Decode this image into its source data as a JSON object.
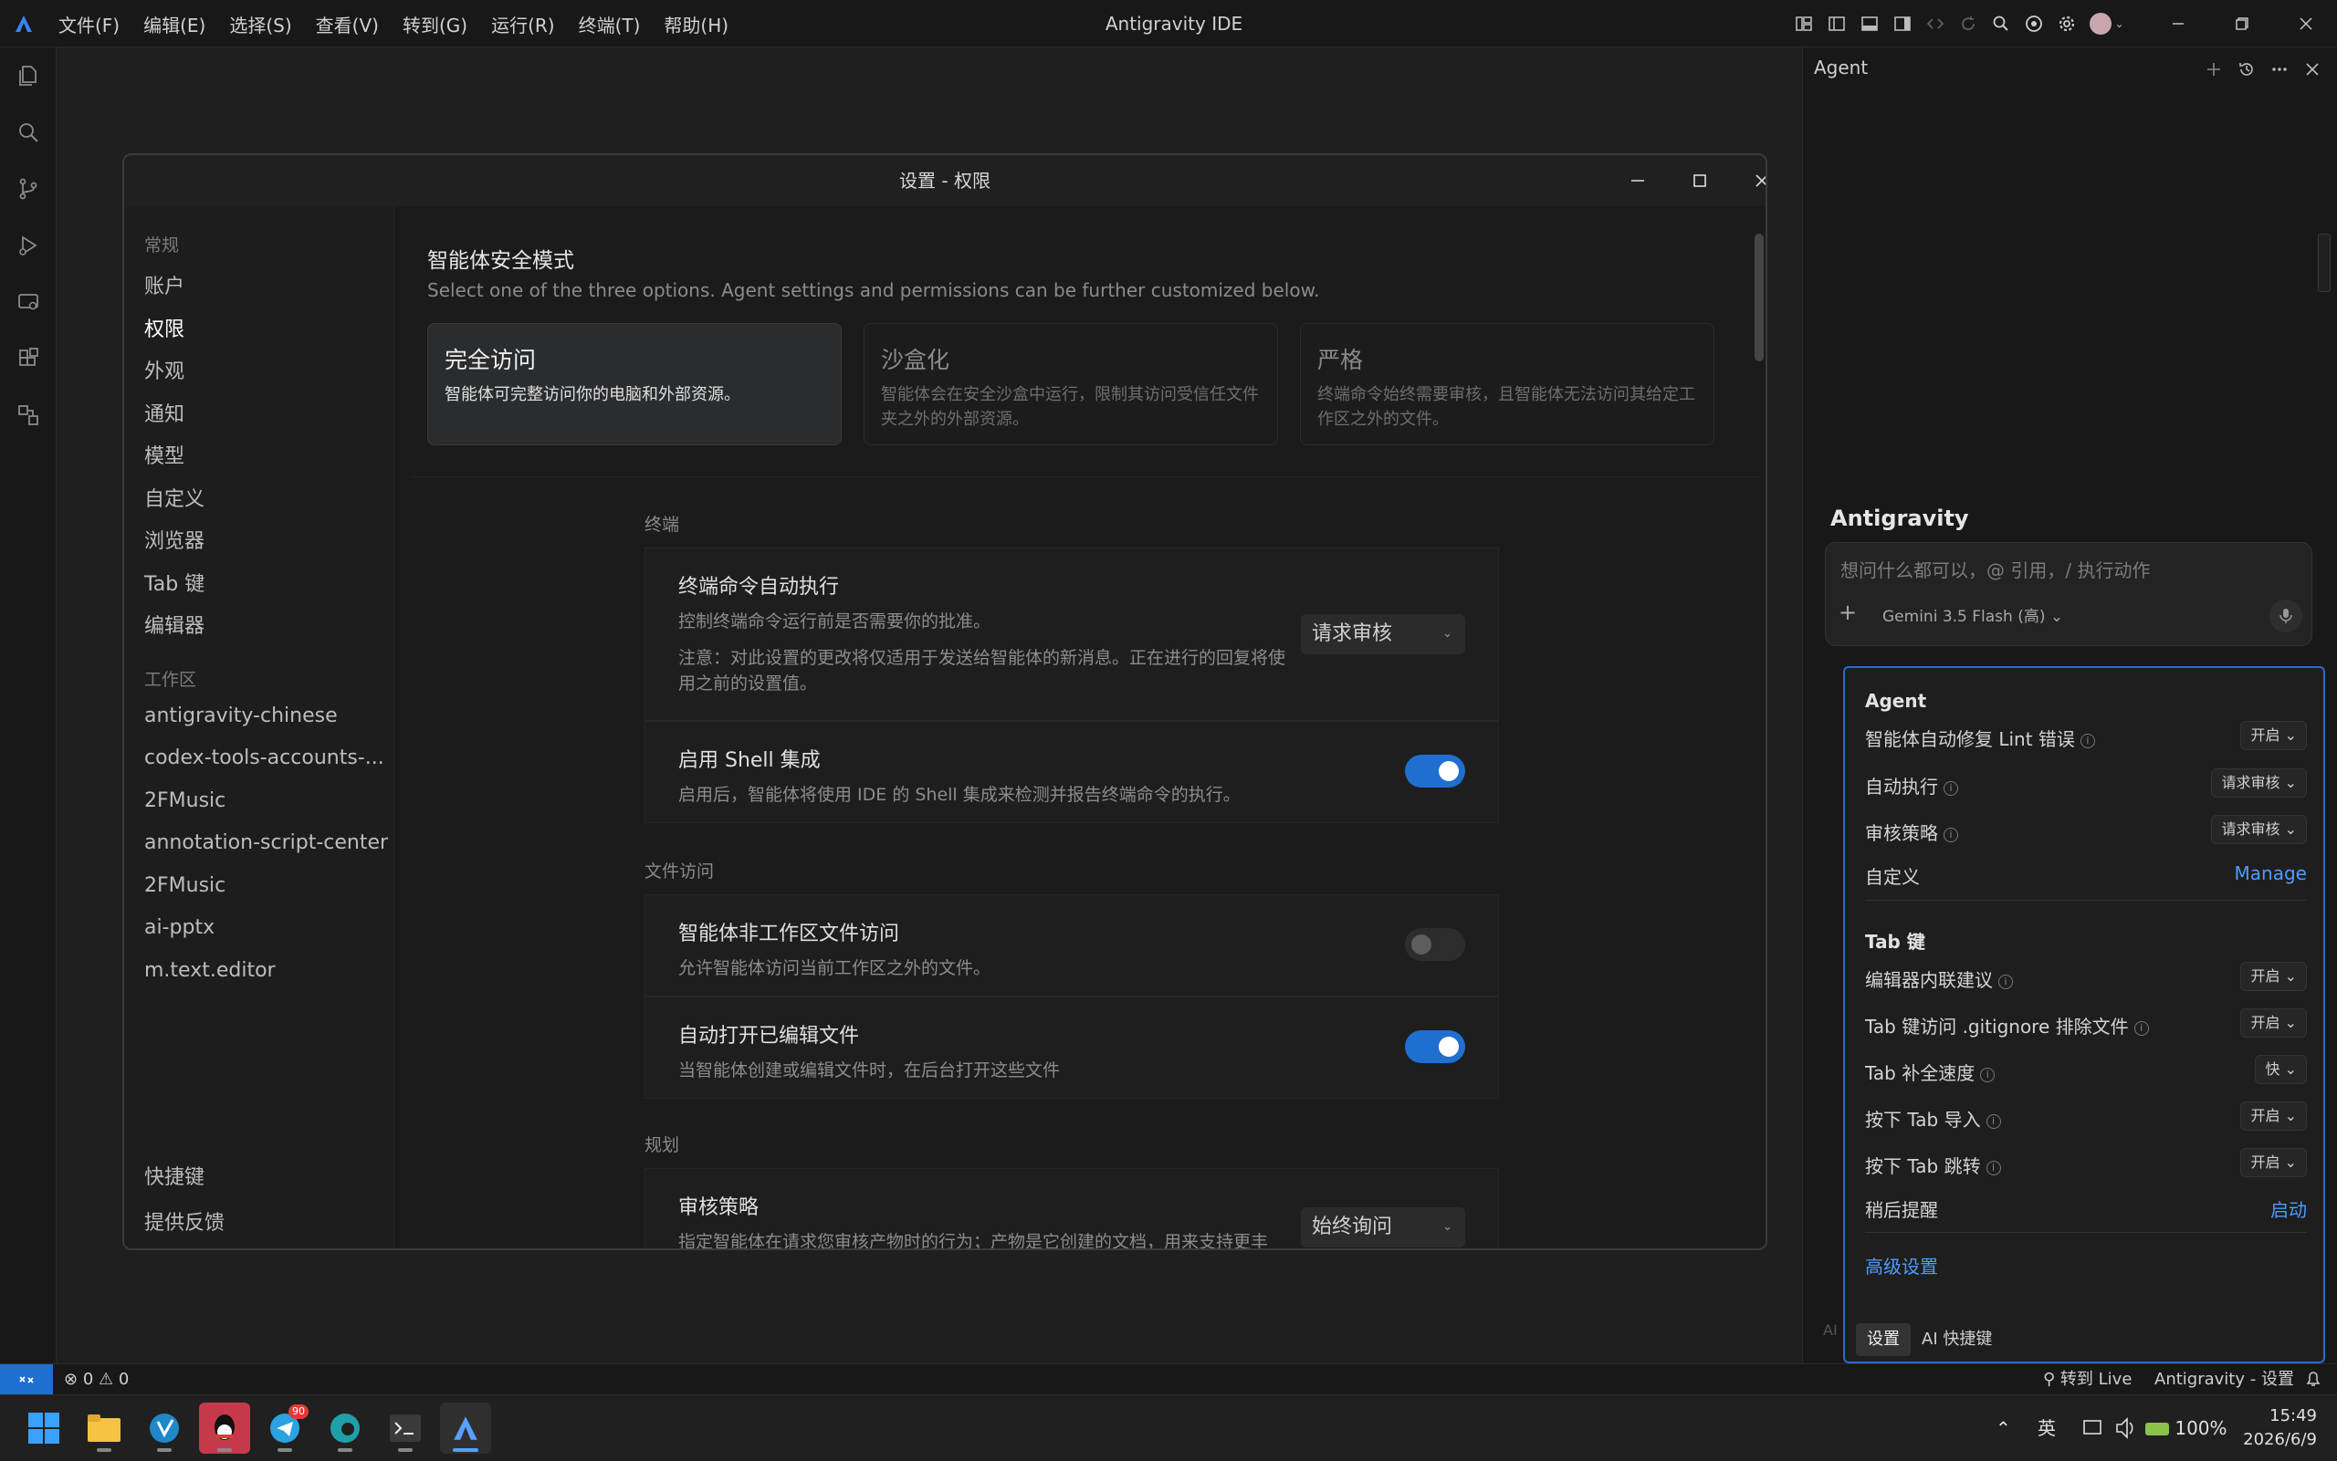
{
  "app": {
    "title": "Antigravity IDE",
    "menu": [
      "文件(F)",
      "编辑(E)",
      "选择(S)",
      "查看(V)",
      "转到(G)",
      "运行(R)",
      "终端(T)",
      "帮助(H)"
    ]
  },
  "colors": {
    "accent": "#1f6fd1",
    "link": "#4d9cff",
    "background": "#1e1e1e"
  },
  "dialog": {
    "title": "设置 - 权限",
    "nav": {
      "general_label": "常规",
      "general_items": [
        "账户",
        "权限",
        "外观",
        "通知",
        "模型",
        "自定义",
        "浏览器",
        "Tab 键",
        "编辑器"
      ],
      "active": "权限",
      "workspace_label": "工作区",
      "workspace_items": [
        "antigravity-chinese",
        "codex-tools-accounts-...",
        "2FMusic",
        "annotation-script-center",
        "2FMusic",
        "ai-pptx",
        "m.text.editor"
      ],
      "bottom_items": [
        "快捷键",
        "提供反馈"
      ]
    },
    "security": {
      "heading": "智能体安全模式",
      "desc": "Select one of the three options. Agent settings and permissions can be further customized below.",
      "modes": [
        {
          "title": "完全访问",
          "desc": "智能体可完整访问你的电脑和外部资源。",
          "selected": true
        },
        {
          "title": "沙盒化",
          "desc": "智能体会在安全沙盒中运行，限制其访问受信任文件夹之外的外部资源。",
          "selected": false
        },
        {
          "title": "严格",
          "desc": "终端命令始终需要审核，且智能体无法访问其给定工作区之外的文件。",
          "selected": false
        }
      ]
    },
    "terminal": {
      "label": "终端",
      "auto_exec": {
        "title": "终端命令自动执行",
        "desc": "控制终端命令运行前是否需要你的批准。",
        "note": "注意：对此设置的更改将仅适用于发送给智能体的新消息。正在进行的回复将使用之前的设置值。",
        "value": "请求审核"
      },
      "shell": {
        "title": "启用 Shell 集成",
        "desc": "启用后，智能体将使用 IDE 的 Shell 集成来检测并报告终端命令的执行。",
        "on": true
      }
    },
    "file_access": {
      "label": "文件访问",
      "non_workspace": {
        "title": "智能体非工作区文件访问",
        "desc": "允许智能体访问当前工作区之外的文件。",
        "on": false
      },
      "auto_open": {
        "title": "自动打开已编辑文件",
        "desc": "当智能体创建或编辑文件时，在后台打开这些文件",
        "on": true
      }
    },
    "planning": {
      "label": "规划",
      "review": {
        "title": "审核策略",
        "desc": "指定智能体在请求您审核产物时的行为；产物是它创建的文档，用来支持更丰富的对话体验。",
        "value": "始终询问"
      }
    }
  },
  "agent": {
    "title": "Agent",
    "brand": "Antigravity",
    "input_placeholder": "想问什么都可以，@ 引用，/ 执行动作",
    "plus": "+",
    "model": "Gemini 3.5 Flash (高)",
    "popup": {
      "agent_header": "Agent",
      "agent_rows": [
        {
          "label": "智能体自动修复 Lint 错误",
          "value": "开启"
        },
        {
          "label": "自动执行",
          "value": "请求审核"
        },
        {
          "label": "审核策略",
          "value": "请求审核"
        }
      ],
      "custom_label": "自定义",
      "custom_link": "Manage",
      "tab_header": "Tab 键",
      "tab_rows": [
        {
          "label": "编辑器内联建议",
          "value": "开启"
        },
        {
          "label": "Tab 键访问 .gitignore 排除文件",
          "value": "开启"
        },
        {
          "label": "Tab 补全速度",
          "value": "快"
        },
        {
          "label": "按下 Tab 导入",
          "value": "开启"
        },
        {
          "label": "按下 Tab 跳转",
          "value": "开启"
        }
      ],
      "later_label": "稍后提醒",
      "later_link": "启动",
      "advanced": "高级设置",
      "footer_tabs": [
        "设置",
        "AI 快捷键"
      ],
      "side_text": "AI"
    }
  },
  "statusbar": {
    "errors": "0",
    "warnings": "0",
    "live": "转到 Live",
    "context": "Antigravity - 设置"
  },
  "taskbar": {
    "badge": "90",
    "ime": "英",
    "battery": "100%",
    "time": "15:49",
    "date": "2026/6/9"
  }
}
